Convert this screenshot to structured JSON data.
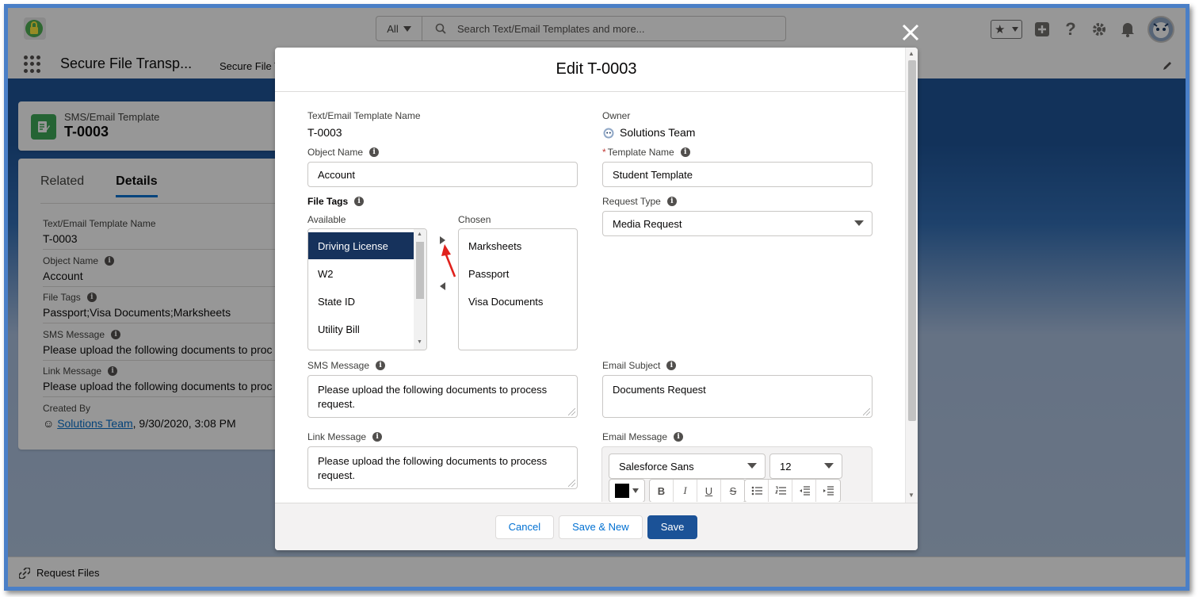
{
  "header": {
    "search_scope": "All",
    "search_placeholder": "Search Text/Email Templates and more..."
  },
  "app_nav": {
    "app_name": "Secure File Transp...",
    "nav_item": "Secure File T"
  },
  "record": {
    "type": "SMS/Email Template",
    "name": "T-0003",
    "tabs": [
      "Related",
      "Details"
    ],
    "fields": [
      {
        "label": "Text/Email Template Name",
        "value": "T-0003",
        "info": false
      },
      {
        "label": "Object Name",
        "value": "Account",
        "info": true
      },
      {
        "label": "File Tags",
        "value": "Passport;Visa Documents;Marksheets",
        "info": true
      },
      {
        "label": "SMS Message",
        "value": "Please upload the following documents to proc",
        "info": true
      },
      {
        "label": "Link Message",
        "value": "Please upload the following documents to proc",
        "info": true
      },
      {
        "label": "Created By",
        "value_link": "Solutions Team",
        "value_rest": ", 9/30/2020, 3:08 PM",
        "info": false
      }
    ]
  },
  "modal": {
    "title": "Edit T-0003",
    "template_name_label": "Text/Email Template Name",
    "template_name_value": "T-0003",
    "owner_label": "Owner",
    "owner_value": "Solutions Team",
    "object_name_label": "Object Name",
    "object_name_value": "Account",
    "req_marker": "*",
    "template_label": "Template Name",
    "template_value": "Student Template",
    "file_tags_label": "File Tags",
    "available_label": "Available",
    "chosen_label": "Chosen",
    "available_items": [
      "Driving License",
      "W2",
      "State ID",
      "Utility Bill"
    ],
    "chosen_items": [
      "Marksheets",
      "Passport",
      "Visa Documents"
    ],
    "request_type_label": "Request Type",
    "request_type_value": "Media Request",
    "sms_label": "SMS Message",
    "sms_value": "Please upload the following documents to process request.",
    "email_subject_label": "Email Subject",
    "email_subject_value": "Documents Request",
    "link_label": "Link Message",
    "link_value": "Please upload the following documents to process request.",
    "email_message_label": "Email Message",
    "font_family": "Salesforce Sans",
    "font_size": "12",
    "toolbar": {
      "bold": "B",
      "italic": "I",
      "underline": "U",
      "strike": "S"
    }
  },
  "footer": {
    "cancel": "Cancel",
    "save_new": "Save & New",
    "save": "Save"
  },
  "utility_bar": {
    "request_files": "Request Files"
  },
  "colors": {
    "brand": "#1b5297",
    "selected_item": "#16325c",
    "record_icon": "#3ba755",
    "link": "#006dcc",
    "annotation_arrow": "#e0211c"
  }
}
